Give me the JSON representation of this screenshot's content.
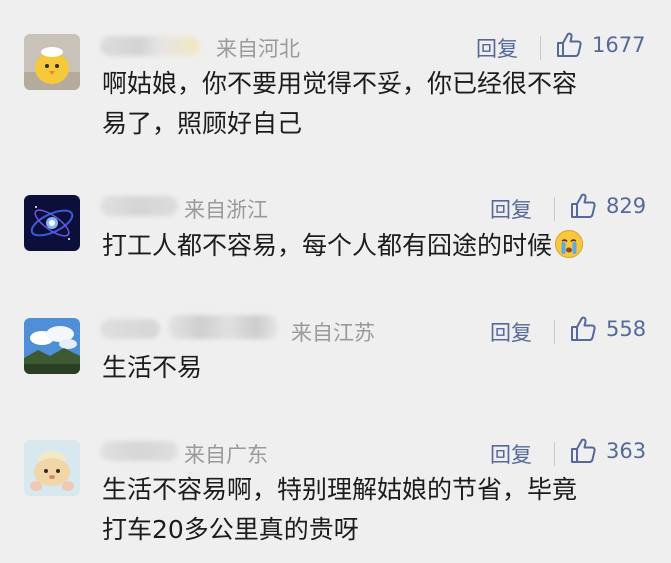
{
  "comments": [
    {
      "location": "来自河北",
      "reply_label": "回复",
      "likes": "1677",
      "lines": [
        "啊姑娘，你不要用觉得不妥，你已经很不容",
        "易了，照顾好自己"
      ],
      "avatar_icon": "chick-avatar-icon"
    },
    {
      "location": "来自浙江",
      "reply_label": "回复",
      "likes": "829",
      "lines": [
        "打工人都不容易，每个人都有囧途的时候"
      ],
      "emoji": "crying-face-emoji",
      "avatar_icon": "galaxy-avatar-icon"
    },
    {
      "location": "来自江苏",
      "reply_label": "回复",
      "likes": "558",
      "lines": [
        "生活不易"
      ],
      "avatar_icon": "sky-landscape-avatar-icon"
    },
    {
      "location": "来自广东",
      "reply_label": "回复",
      "likes": "363",
      "lines": [
        "生活不容易啊，特别理解姑娘的节省，毕竟",
        "打车20多公里真的贵呀"
      ],
      "avatar_icon": "plush-toy-avatar-icon"
    }
  ],
  "colors": {
    "background": "#efefef",
    "link_blue": "#56699a",
    "meta_gray": "#9a9a9a"
  }
}
